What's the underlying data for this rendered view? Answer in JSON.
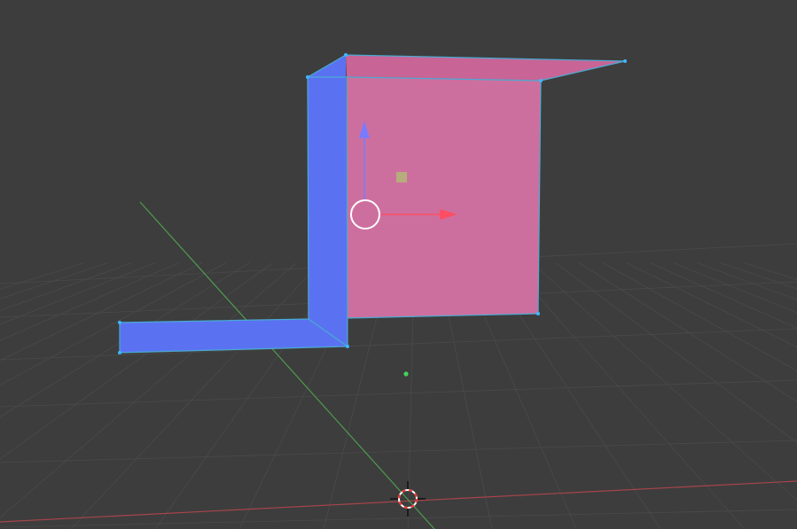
{
  "viewport": {
    "background": "#3d3d3d",
    "grid_color": "#4a4a4a",
    "x_axis_color": "#a8454b",
    "y_axis_color": "#4f9a4f"
  },
  "mesh": {
    "blue_face_color": "#5a72f2",
    "blue_edge_color": "#4d63e3",
    "pink_face_color": "#cd6f9e",
    "pink_top_color": "#c86496",
    "outline_color": "#4aaad2",
    "vertex_color": "#3fb6ff"
  },
  "gizmo": {
    "x_arrow_color": "#ff4d63",
    "z_arrow_color": "#7a7aff",
    "center_ring_color": "#ffffff",
    "scale_box_color": "#b8ab7d"
  },
  "origin_dot_color": "#41d35a",
  "cursor_3d": {
    "ring_color_a": "#ffffff",
    "ring_color_b": "#ff3030",
    "crosshair_color": "#111111"
  }
}
